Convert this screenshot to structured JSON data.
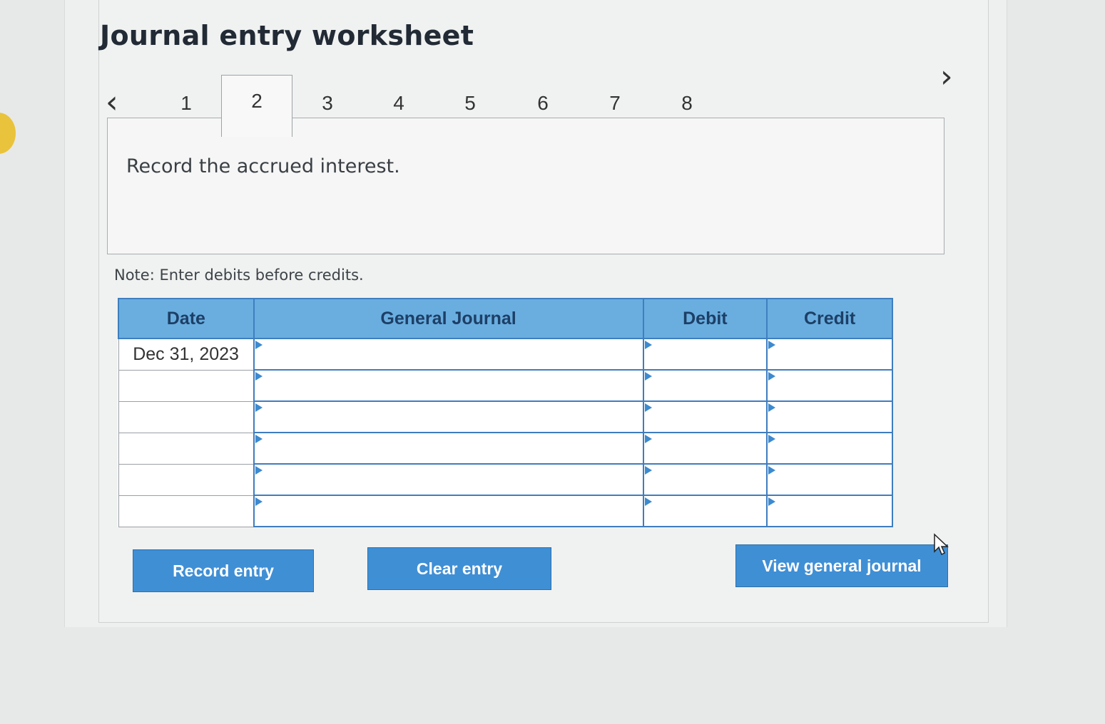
{
  "title": "Journal entry worksheet",
  "nav": {
    "prev_icon": "chevron-left-icon",
    "next_icon": "chevron-right-icon"
  },
  "tabs": [
    "1",
    "2",
    "3",
    "4",
    "5",
    "6",
    "7",
    "8"
  ],
  "active_tab": "2",
  "instruction": "Record the accrued interest.",
  "note": "Note: Enter debits before credits.",
  "table": {
    "headers": {
      "date": "Date",
      "journal": "General Journal",
      "debit": "Debit",
      "credit": "Credit"
    },
    "rows": [
      {
        "date": "Dec 31, 2023",
        "account": "",
        "debit": "",
        "credit": ""
      },
      {
        "date": "",
        "account": "",
        "debit": "",
        "credit": ""
      },
      {
        "date": "",
        "account": "",
        "debit": "",
        "credit": ""
      },
      {
        "date": "",
        "account": "",
        "debit": "",
        "credit": ""
      },
      {
        "date": "",
        "account": "",
        "debit": "",
        "credit": ""
      },
      {
        "date": "",
        "account": "",
        "debit": "",
        "credit": ""
      }
    ]
  },
  "buttons": {
    "record": "Record entry",
    "clear": "Clear entry",
    "view": "View general journal"
  },
  "colors": {
    "accent": "#3f8fd5",
    "header_bg": "#6aaee0",
    "header_text": "#1d3f66"
  }
}
